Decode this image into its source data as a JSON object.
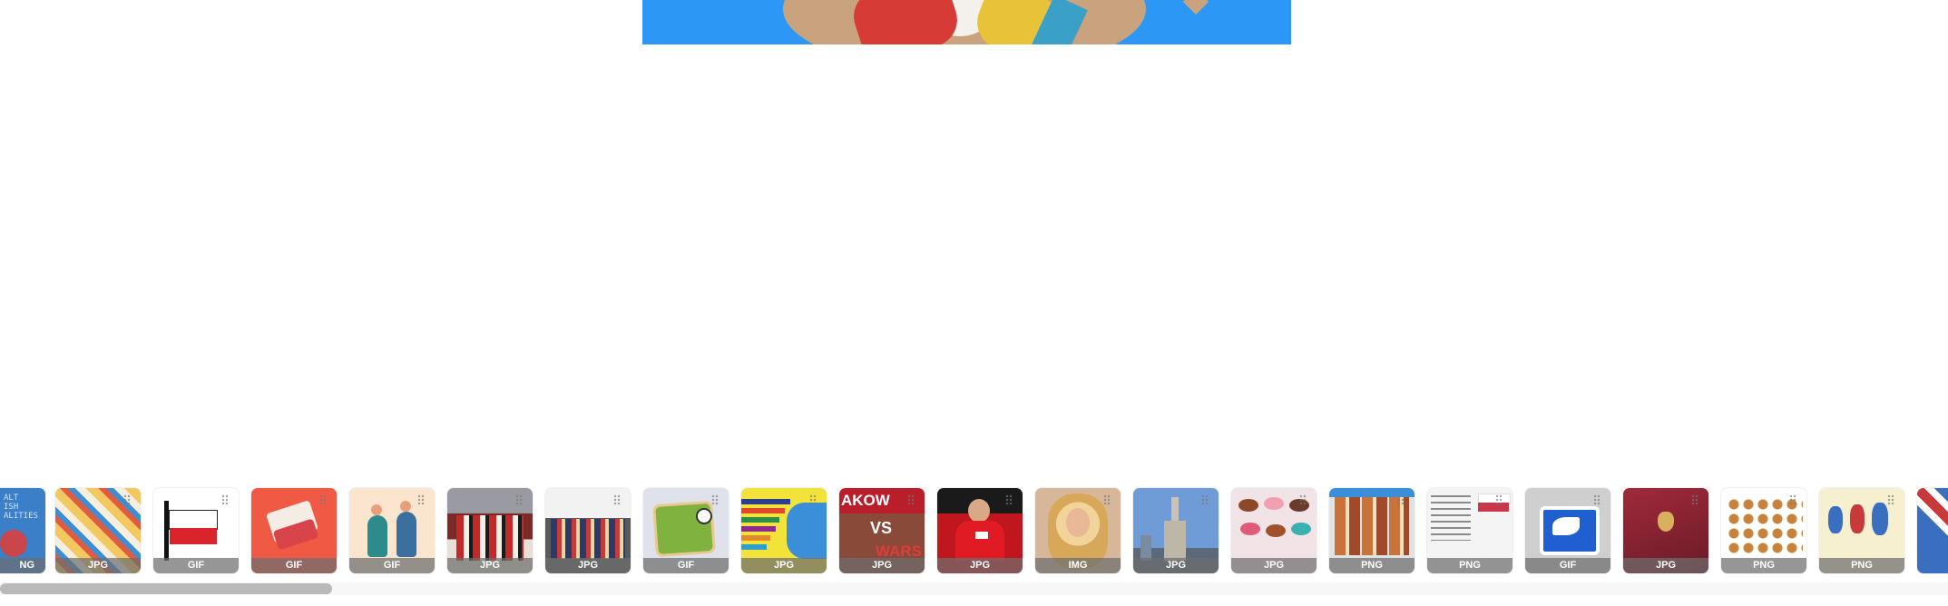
{
  "preview": {
    "icon": "3d-character-image"
  },
  "thumbnails": [
    {
      "type": "NG",
      "icon": "blue-collage-thumbnail",
      "bg": "#3a7fc8",
      "art_text": "ALT\nISH\nALITIES"
    },
    {
      "type": "JPG",
      "icon": "doodle-collage-thumbnail",
      "bg": "#f3c860"
    },
    {
      "type": "GIF",
      "icon": "polish-flag-thumbnail",
      "bg": "#ffffff"
    },
    {
      "type": "GIF",
      "icon": "waving-flag-thumbnail",
      "bg": "#f05a45"
    },
    {
      "type": "GIF",
      "icon": "dancers-illustration-thumbnail",
      "bg": "#fbe5cf"
    },
    {
      "type": "JPG",
      "icon": "folk-parade-photo-thumbnail",
      "bg": "#7b2a2a"
    },
    {
      "type": "JPG",
      "icon": "folk-costume-group-thumbnail",
      "bg": "#5a5a5a"
    },
    {
      "type": "GIF",
      "icon": "map-illustration-thumbnail",
      "bg": "#dfe2ea"
    },
    {
      "type": "JPG",
      "icon": "bar-chart-map-thumbnail",
      "bg": "#f2e23a"
    },
    {
      "type": "JPG",
      "icon": "krakow-vs-warsaw-thumbnail",
      "bg": "#8a4a3a",
      "art_top": "AKOW",
      "art_mid": "VS",
      "art_bottom": "WARS"
    },
    {
      "type": "JPG",
      "icon": "footballer-photo-thumbnail",
      "bg": "#c0161d"
    },
    {
      "type": "IMG",
      "icon": "singer-portrait-thumbnail",
      "bg": "#d7b79a"
    },
    {
      "type": "JPG",
      "icon": "palace-of-culture-thumbnail",
      "bg": "#6f9bd6"
    },
    {
      "type": "JPG",
      "icon": "pastries-thumbnail",
      "bg": "#f2e3e6"
    },
    {
      "type": "PNG",
      "icon": "food-grid-thumbnail",
      "bg": "#e2e2e2"
    },
    {
      "type": "PNG",
      "icon": "flag-infographic-thumbnail",
      "bg": "#f4f4f4"
    },
    {
      "type": "GIF",
      "icon": "sports-icon-thumbnail",
      "bg": "#cfcfcf"
    },
    {
      "type": "JPG",
      "icon": "passport-thumbnail",
      "bg": "#8b2332"
    },
    {
      "type": "PNG",
      "icon": "dishes-chart-thumbnail",
      "bg": "#ffffff"
    },
    {
      "type": "PNG",
      "icon": "uk-map-thumbnail",
      "bg": "#f7f0d0"
    },
    {
      "type": "",
      "icon": "uk-flag-map-thumbnail",
      "bg": "#3a6fbf"
    }
  ]
}
